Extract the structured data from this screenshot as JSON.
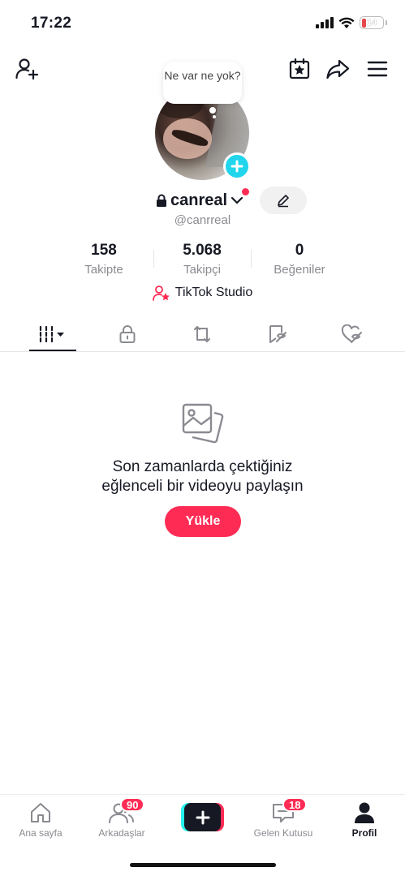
{
  "status_bar": {
    "time": "17:22",
    "battery_level": "14",
    "battery_fraction": 0.14,
    "icons": [
      "signal-icon",
      "wifi-icon",
      "battery-icon"
    ]
  },
  "header": {
    "icons": [
      "add-friend-icon",
      "calendar-star-icon",
      "share-icon",
      "menu-icon"
    ]
  },
  "profile": {
    "note_bubble": "Ne var ne yok?",
    "username": "canreal",
    "handle": "@canrreal",
    "stats": [
      {
        "value": "158",
        "label": "Takipte"
      },
      {
        "value": "5.068",
        "label": "Takipçi"
      },
      {
        "value": "0",
        "label": "Beğeniler"
      }
    ],
    "studio_label": "TikTok Studio"
  },
  "tabs": {
    "items": [
      "videos-grid-icon",
      "private-lock-icon",
      "repost-icon",
      "favorites-icon",
      "liked-icon"
    ],
    "active": "videos-grid-icon"
  },
  "empty_state": {
    "line1": "Son zamanlarda çektiğiniz",
    "line2": "eğlenceli bir videoyu paylaşın",
    "button": "Yükle"
  },
  "bottom_nav": {
    "home": "Ana sayfa",
    "friends": "Arkadaşlar",
    "friends_badge": "90",
    "inbox": "Gelen Kutusu",
    "inbox_badge": "18",
    "profile": "Profil"
  },
  "colors": {
    "accent": "#fe2c55",
    "cyan": "#20d5ec",
    "text": "#161823",
    "muted": "#8a8b91"
  }
}
